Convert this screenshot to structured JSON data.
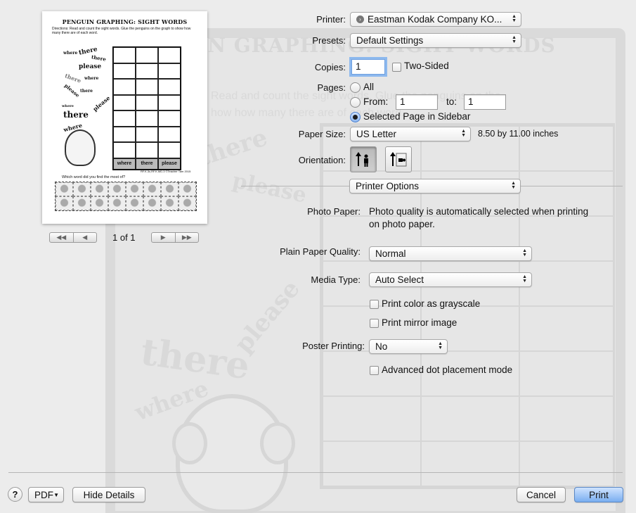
{
  "preview": {
    "worksheet_title": "PENGUIN GRAPHING:  SIGHT WORDS",
    "directions": "Directions:  Read and count the sight words.  Glue the penguins on the graph to show how many there are of each word.",
    "graph_labels": [
      "where",
      "there",
      "please"
    ],
    "question": "Which word did you find the most of?",
    "credit": "RF.K.3c,RF.K.MD.3  ©Teacher Tam 2015",
    "page_count_text": "1 of 1"
  },
  "backdrop": {
    "title": "PENGUIN GRAPHING:  SIGHT WORDS",
    "line1": "Read and count the sight words.  Glue the penguins on the",
    "line2": "how how many there are of each word."
  },
  "printer": {
    "label": "Printer:",
    "value": "Eastman Kodak Company KO..."
  },
  "presets": {
    "label": "Presets:",
    "value": "Default Settings"
  },
  "copies": {
    "label": "Copies:",
    "value": "1",
    "two_sided_label": "Two-Sided",
    "two_sided_checked": false
  },
  "pages": {
    "label": "Pages:",
    "all_label": "All",
    "from_label": "From:",
    "from_value": "1",
    "to_label": "to:",
    "to_value": "1",
    "selected_label": "Selected Page in Sidebar",
    "selected": "Selected Page in Sidebar"
  },
  "paper_size": {
    "label": "Paper Size:",
    "value": "US Letter",
    "dimensions": "8.50 by 11.00 inches"
  },
  "orientation": {
    "label": "Orientation:",
    "selected": "portrait"
  },
  "section": {
    "value": "Printer Options"
  },
  "photo_paper": {
    "label": "Photo Paper:",
    "text_line1": "Photo quality is automatically selected when printing",
    "text_line2": "on photo paper."
  },
  "plain_paper_quality": {
    "label": "Plain Paper Quality:",
    "value": "Normal"
  },
  "media_type": {
    "label": "Media Type:",
    "value": "Auto Select"
  },
  "grayscale": {
    "label": "Print color as grayscale",
    "checked": false
  },
  "mirror": {
    "label": "Print mirror image",
    "checked": false
  },
  "poster_printing": {
    "label": "Poster Printing:",
    "value": "No"
  },
  "advanced_dot": {
    "label": "Advanced dot placement mode",
    "checked": false
  },
  "footer": {
    "help_label": "?",
    "pdf_label": "PDF",
    "hide_details_label": "Hide Details",
    "cancel_label": "Cancel",
    "print_label": "Print"
  },
  "colors": {
    "accent": "#7aaef0",
    "focus_ring": "#8db9ee",
    "background": "#ececec"
  }
}
